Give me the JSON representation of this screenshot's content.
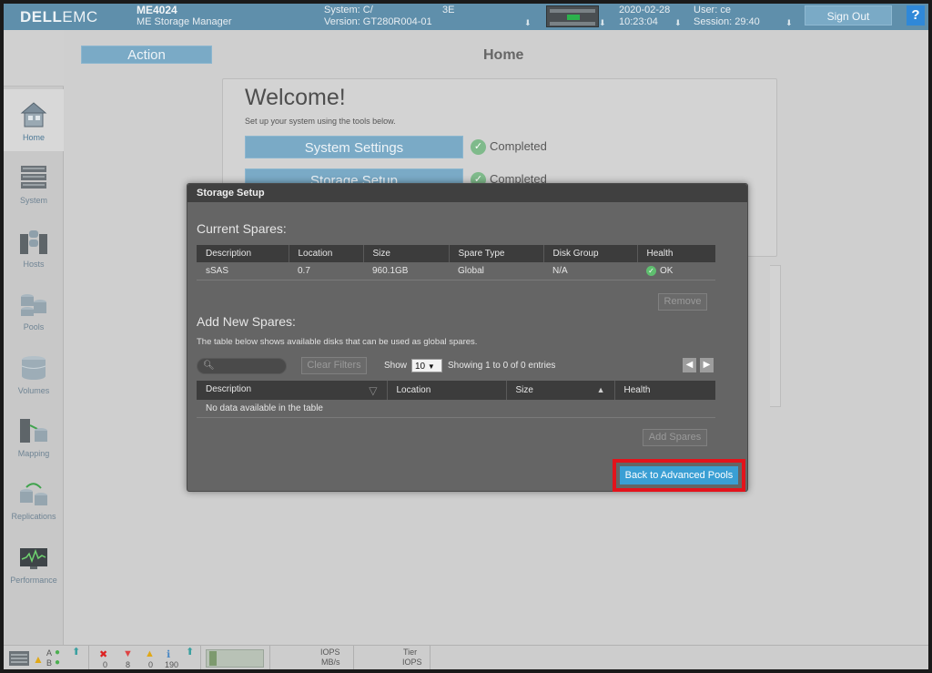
{
  "header": {
    "logo_brand": "DELL",
    "logo_suffix": "EMC",
    "model": "ME4024",
    "product": "ME Storage Manager",
    "system_label": "System: C/",
    "version_label": "Version: GT280R004-01",
    "code": "3E",
    "date": "2020-02-28",
    "time": "10:23:04",
    "user_label": "User: ce",
    "session_label": "Session: 29:40",
    "sign_out": "Sign Out",
    "help": "?"
  },
  "sidebar": {
    "items": [
      {
        "label": "Home",
        "icon": "home-icon"
      },
      {
        "label": "System",
        "icon": "system-icon"
      },
      {
        "label": "Hosts",
        "icon": "hosts-icon"
      },
      {
        "label": "Pools",
        "icon": "pools-icon"
      },
      {
        "label": "Volumes",
        "icon": "volumes-icon"
      },
      {
        "label": "Mapping",
        "icon": "mapping-icon"
      },
      {
        "label": "Replications",
        "icon": "replications-icon"
      },
      {
        "label": "Performance",
        "icon": "performance-icon"
      }
    ]
  },
  "main": {
    "action_label": "Action",
    "page_title": "Home",
    "welcome": {
      "title": "Welcome!",
      "subtitle": "Set up your system using the tools below.",
      "steps": [
        {
          "label": "System Settings",
          "status": "Completed"
        },
        {
          "label": "Storage Setup",
          "status": "Completed"
        }
      ]
    }
  },
  "dialog": {
    "title": "Storage Setup",
    "current_spares": {
      "heading": "Current Spares:",
      "columns": [
        "Description",
        "Location",
        "Size",
        "Spare Type",
        "Disk Group",
        "Health"
      ],
      "rows": [
        [
          "sSAS",
          "0.7",
          "960.1GB",
          "Global",
          "N/A",
          "OK"
        ]
      ],
      "remove_label": "Remove"
    },
    "add_spares": {
      "heading": "Add New Spares:",
      "description": "The table below shows available disks that can be used as global spares.",
      "clear_filters": "Clear Filters",
      "show_label": "Show",
      "show_value": "10",
      "showing_text": "Showing 1 to 0 of 0 entries",
      "columns": [
        "Description",
        "Location",
        "Size",
        "Health"
      ],
      "empty_text": "No data available in the table",
      "add_label": "Add Spares"
    },
    "back_label": "Back to Advanced Pools"
  },
  "footer": {
    "ctrl_a": "A",
    "ctrl_b": "B",
    "counts": [
      "0",
      "8",
      "0",
      "190"
    ],
    "iops": "IOPS",
    "mbs": "MB/s",
    "tier": "Tier",
    "tier_iops": "IOPS"
  },
  "colors": {
    "header_bg": "#5f8fab",
    "button_blue": "#7aaac6",
    "dialog_bg": "#656565",
    "primary_button": "#3a9fd4",
    "highlight_border": "#e3131b",
    "ok_green": "#5fbe6f"
  }
}
